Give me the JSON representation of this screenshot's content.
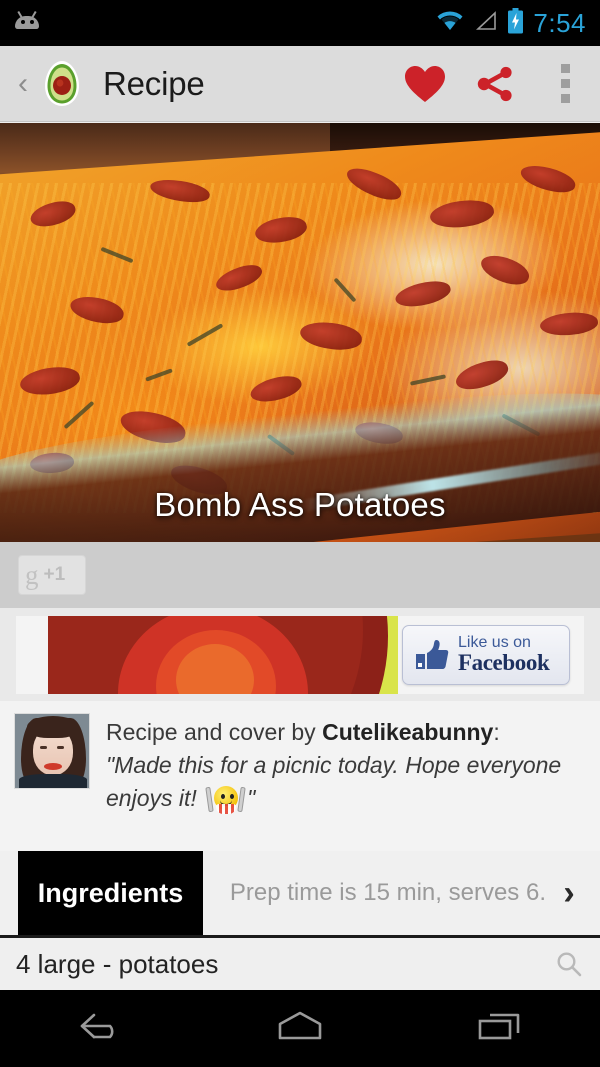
{
  "status_bar": {
    "notification_icon": "android-droid-icon",
    "wifi_icon": "wifi-icon",
    "signal_icon": "signal-empty-icon",
    "battery_icon": "battery-charging-icon",
    "time": "7:54",
    "accent_color": "#2aa3d8",
    "background_color": "#000000"
  },
  "action_bar": {
    "back_label": "‹",
    "app_icon": "avocado-icon",
    "title": "Recipe",
    "favorite_icon": "heart-icon",
    "share_icon": "share-icon",
    "overflow_icon": "overflow-menu-icon",
    "background_color": "#dcdcdc",
    "accent_color": "#cc2229"
  },
  "hero": {
    "title": "Bomb Ass Potatoes",
    "photo_alt": "cheesy-bacon-potato-casserole-photo"
  },
  "social": {
    "plus_one_glyph": "g",
    "plus_one_label": "+1",
    "plus_one_name": "google-plus-one-button"
  },
  "ad": {
    "graphic": "avocado-graphic",
    "fb_icon": "thumbs-up-icon",
    "fb_line1": "Like us on",
    "fb_line2": "Facebook",
    "fb_brand_color": "#3b5998"
  },
  "comment": {
    "avatar": "user-avatar",
    "byline_prefix": "Recipe and cover by ",
    "author": "Cutelikeabunny",
    "byline_suffix": ":",
    "quote_open": "\"Made this for a picnic today.  Hope everyone",
    "quote_line2": "enjoys it! ",
    "emoji": "smiley-with-fork-and-knife-emoji",
    "quote_close": "\""
  },
  "tabs": {
    "active_label": "Ingredients",
    "meta_text": "Prep time is 15 min, serves 6.",
    "next_chevron": "›"
  },
  "ingredients": [
    {
      "text": "4 large - potatoes"
    }
  ],
  "list_actions": {
    "search_icon": "search-icon"
  },
  "nav_bar": {
    "back_icon": "nav-back-icon",
    "home_icon": "nav-home-icon",
    "recents_icon": "nav-recents-icon",
    "background_color": "#000000"
  }
}
